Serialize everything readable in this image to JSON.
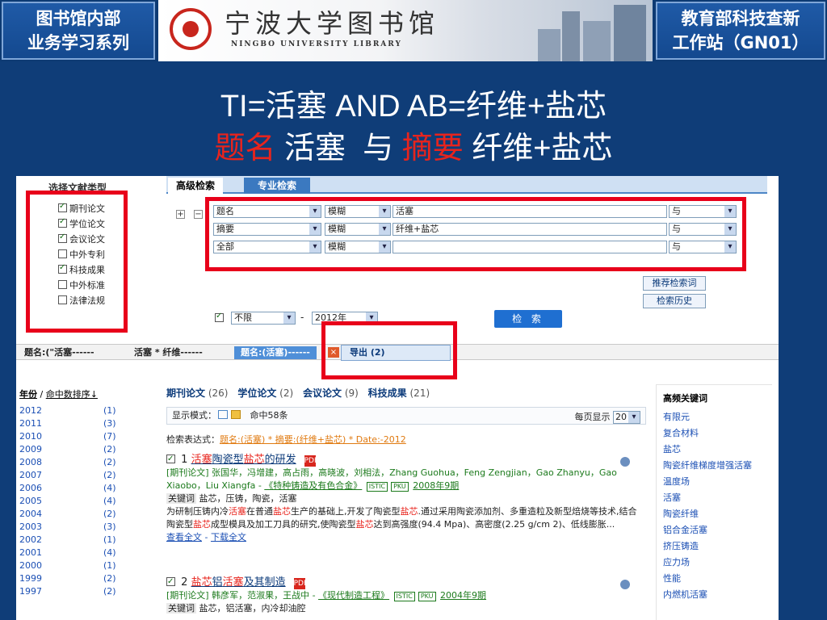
{
  "banner": {
    "left_title_line1": "图书馆内部",
    "left_title_line2": "业务学习系列",
    "library_name_cn": "宁波大学图书馆",
    "library_name_en": "NINGBO UNIVERSITY LIBRARY",
    "right_title_line1": "教育部科技查新",
    "right_title_line2": "工作站（GN01）"
  },
  "slide": {
    "title_line1": "TI=活塞 AND AB=纤维+盐芯",
    "title_line2_parts": [
      {
        "text": "题名",
        "red": true
      },
      {
        "text": " 活塞  与 ",
        "red": false
      },
      {
        "text": "摘要",
        "red": true
      },
      {
        "text": " 纤维+盐芯",
        "red": false
      }
    ]
  },
  "search_ui": {
    "types_title": "选择文献类型",
    "doc_types": [
      {
        "label": "期刊论文",
        "checked": true
      },
      {
        "label": "学位论文",
        "checked": true
      },
      {
        "label": "会议论文",
        "checked": true
      },
      {
        "label": "中外专利",
        "checked": false
      },
      {
        "label": "科技成果",
        "checked": true
      },
      {
        "label": "中外标准",
        "checked": false
      },
      {
        "label": "法律法规",
        "checked": false
      }
    ],
    "tabs": [
      "高级检索",
      "专业检索"
    ],
    "rows": [
      {
        "field": "题名",
        "match": "模糊",
        "value": "活塞",
        "logic": "与"
      },
      {
        "field": "摘要",
        "match": "模糊",
        "value": "纤维+盐芯",
        "logic": "与"
      },
      {
        "field": "全部",
        "match": "模糊",
        "value": "",
        "logic": "与"
      }
    ],
    "plus": "+",
    "minus": "−",
    "recommend_btn": "推荐检索词",
    "history_btn": "检索历史",
    "date_from": "不限",
    "date_to": "2012年",
    "search_btn": "检 索"
  },
  "history_bar": {
    "items": [
      "题名:(\"活塞------",
      "活塞 * 纤维------",
      "题名:(活塞)------"
    ],
    "export": "导出 (2)",
    "close": "×"
  },
  "years": {
    "sort_label": "年份",
    "sep": " / ",
    "sort_alt": "命中数排序↓",
    "list": [
      {
        "year": "2012",
        "count": "(1)"
      },
      {
        "year": "2011",
        "count": "(3)"
      },
      {
        "year": "2010",
        "count": "(7)"
      },
      {
        "year": "2009",
        "count": "(2)"
      },
      {
        "year": "2008",
        "count": "(2)"
      },
      {
        "year": "2007",
        "count": "(2)"
      },
      {
        "year": "2006",
        "count": "(4)"
      },
      {
        "year": "2005",
        "count": "(4)"
      },
      {
        "year": "2004",
        "count": "(2)"
      },
      {
        "year": "2003",
        "count": "(3)"
      },
      {
        "year": "2002",
        "count": "(1)"
      },
      {
        "year": "2001",
        "count": "(4)"
      },
      {
        "year": "2000",
        "count": "(1)"
      },
      {
        "year": "1999",
        "count": "(2)"
      },
      {
        "year": "1997",
        "count": "(2)"
      }
    ]
  },
  "results": {
    "categories": [
      {
        "name": "期刊论文",
        "count": "(26)"
      },
      {
        "name": "学位论文",
        "count": "(2)"
      },
      {
        "name": "会议论文",
        "count": "(9)"
      },
      {
        "name": "科技成果",
        "count": "(21)"
      }
    ],
    "mode_label": "显示模式：",
    "hits": "命中58条",
    "per_page_label": "每页显示",
    "per_page_value": "20",
    "expr_label": "检索表达式：",
    "expr_value": "题名:(活塞) * 摘要:(纤维+盐芯) * Date:-2012",
    "items": [
      {
        "num": "1",
        "title_parts": [
          {
            "t": "活塞",
            "hl": true
          },
          {
            "t": "陶瓷型",
            "hl": false
          },
          {
            "t": "盐芯",
            "hl": true
          },
          {
            "t": "的研发",
            "hl": false
          }
        ],
        "meta_prefix": "[期刊论文] 张国华，冯增建，高占雨，高晓波，刘相法，Zhang Guohua，Feng Zengjian，Gao Zhanyu，Gao Xiaobo，Liu Xiangfa - ",
        "source": "《特种铸造及有色合金》",
        "tags": [
          "ISTIC",
          "PKU"
        ],
        "issue": "2008年9期",
        "kw_label": "关键词",
        "keywords": " 盐芯，压铸，陶瓷，活塞",
        "abstract_parts": [
          {
            "t": "为研制压铸内冷",
            "hl": false
          },
          {
            "t": "活塞",
            "hl": true
          },
          {
            "t": "在普通",
            "hl": false
          },
          {
            "t": "盐芯",
            "hl": true
          },
          {
            "t": "生产的基础上,开发了陶瓷型",
            "hl": false
          },
          {
            "t": "盐芯",
            "hl": true
          },
          {
            "t": ".通过采用陶瓷添加剂、多重造粒及新型焙烧等技术,结合陶瓷型",
            "hl": false
          },
          {
            "t": "盐芯",
            "hl": true
          },
          {
            "t": "成型模具及加工刀具的研究,使陶瓷型",
            "hl": false
          },
          {
            "t": "盐芯",
            "hl": true
          },
          {
            "t": "达到高强度(94.4 Mpa)、高密度(2.25 g/cm 2)、低线膨胀...",
            "hl": false
          }
        ],
        "view": "查看全文",
        "dash": " - ",
        "download": "下载全文"
      },
      {
        "num": "2",
        "title_parts": [
          {
            "t": "盐芯",
            "hl": true
          },
          {
            "t": "铝",
            "hl": false
          },
          {
            "t": "活塞",
            "hl": true
          },
          {
            "t": "及其制造",
            "hl": false
          }
        ],
        "meta_prefix": "[期刊论文] 韩彦军，范淑果，王战中 - ",
        "source": "《现代制造工程》",
        "tags": [
          "ISTIC",
          "PKU"
        ],
        "issue": "2004年9期",
        "kw_label": "关键词",
        "keywords": " 盐芯，铝活塞，内冷却油腔"
      }
    ]
  },
  "keywords_panel": {
    "title": "高频关键词",
    "items": [
      "有限元",
      "复合材料",
      "盐芯",
      "陶瓷纤维梯度增强活塞",
      "温度场",
      "活塞",
      "陶瓷纤维",
      "铝合金活塞",
      "挤压铸造",
      "应力场",
      "性能",
      "内燃机活塞"
    ]
  },
  "icons": {
    "pdf": "PDF",
    "seal": "university-seal"
  },
  "colors": {
    "slide_bg": "#0f3d78",
    "highlight_red": "#e8001a",
    "title_red": "#e8241d"
  }
}
